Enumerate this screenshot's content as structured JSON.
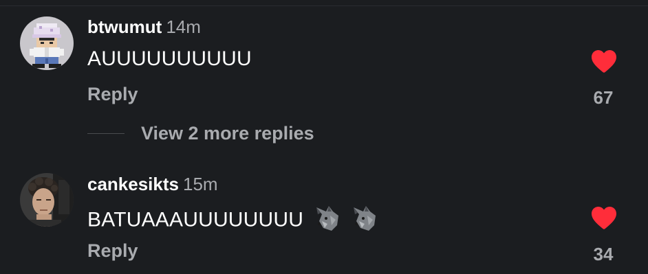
{
  "colors": {
    "background": "#1b1d20",
    "muted_text": "#a9abaf",
    "heart": "#ff2d3a",
    "primary_text": "#ffffff"
  },
  "comments": [
    {
      "username": "btwumut",
      "time": "14m",
      "text": "AUUUUUUUUUU",
      "emoji": [],
      "reply_label": "Reply",
      "likes": "67",
      "liked": true,
      "avatar_icon": "pixel-character-avatar"
    },
    {
      "username": "cankesikts",
      "time": "15m",
      "text": "BATUAAAUUUUUUUU",
      "emoji": [
        "wolf-emoji",
        "wolf-emoji"
      ],
      "reply_label": "Reply",
      "likes": "34",
      "liked": true,
      "avatar_icon": "photo-avatar"
    }
  ],
  "view_more_replies": "View 2 more replies"
}
